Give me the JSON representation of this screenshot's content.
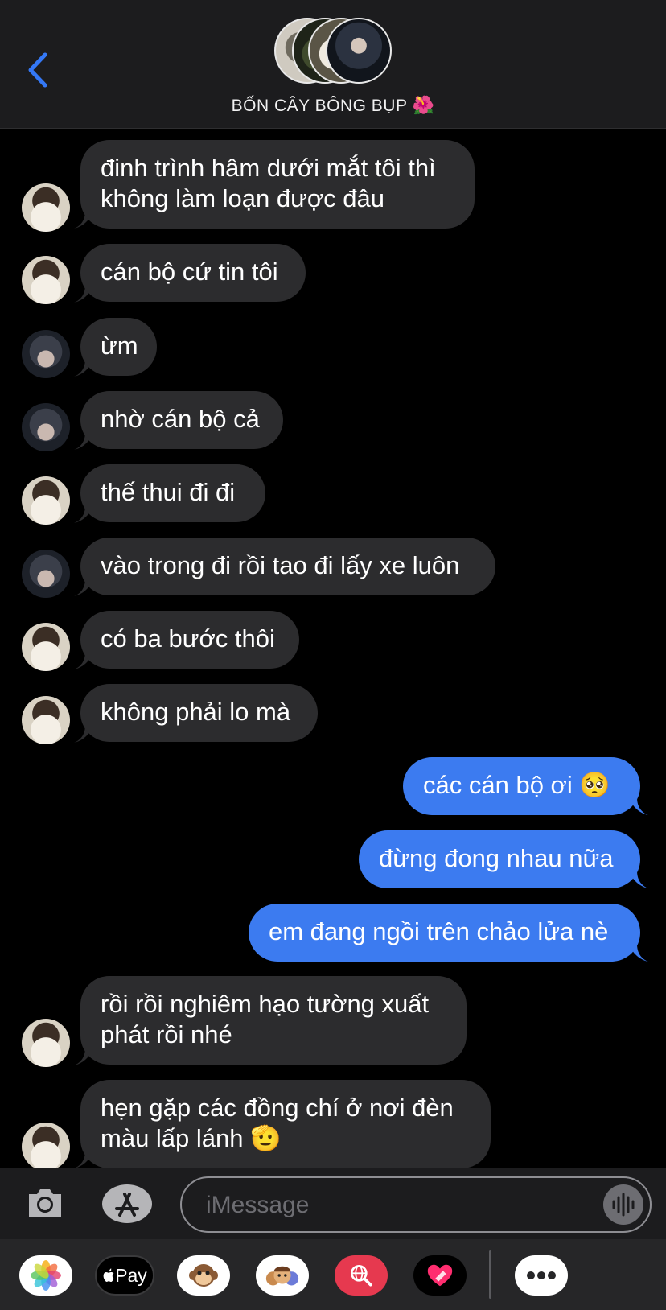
{
  "header": {
    "title": "BỐN CÂY BÔNG BỤP",
    "title_emoji": "🌺",
    "accent_color": "#3478f6"
  },
  "messages": [
    {
      "from": "other",
      "lines": [
        "đinh trình hâm dưới mắt tôi thì",
        "không làm loạn được đâu"
      ]
    },
    {
      "from": "other",
      "lines": [
        "cán bộ cứ tin tôi"
      ]
    },
    {
      "from": "other",
      "lines": [
        "ừm"
      ]
    },
    {
      "from": "other",
      "lines": [
        "nhờ cán bộ cả"
      ]
    },
    {
      "from": "other",
      "lines": [
        "thế thui đi đi"
      ]
    },
    {
      "from": "other",
      "lines": [
        "vào trong đi rồi tao đi lấy xe luôn"
      ]
    },
    {
      "from": "other",
      "lines": [
        "có ba bước thôi"
      ]
    },
    {
      "from": "other",
      "lines": [
        "không phải lo mà"
      ]
    },
    {
      "from": "me",
      "lines": [
        "các cán bộ ơi 🥺"
      ]
    },
    {
      "from": "me",
      "lines": [
        "đừng đong nhau nữa"
      ]
    },
    {
      "from": "me",
      "lines": [
        "em đang ngồi trên chảo lửa nè"
      ]
    },
    {
      "from": "other",
      "lines": [
        "rồi rồi nghiêm hạo tường xuất",
        "phát rồi nhé"
      ]
    },
    {
      "from": "other",
      "lines": [
        "hẹn gặp các đồng chí ở nơi đèn",
        "màu lấp lánh 🫡"
      ]
    }
  ],
  "input": {
    "placeholder": "iMessage",
    "value": ""
  },
  "drawer": {
    "apple_pay_label": "Pay",
    "items": [
      "photos-icon",
      "apple-pay-icon",
      "monkey-memoji-icon",
      "memoji-icon",
      "web-search-icon",
      "digital-touch-icon",
      "more-icon"
    ]
  },
  "colors": {
    "incoming_bubble": "#2c2c2e",
    "outgoing_bubble": "#3c7bf0",
    "background": "#000000"
  }
}
